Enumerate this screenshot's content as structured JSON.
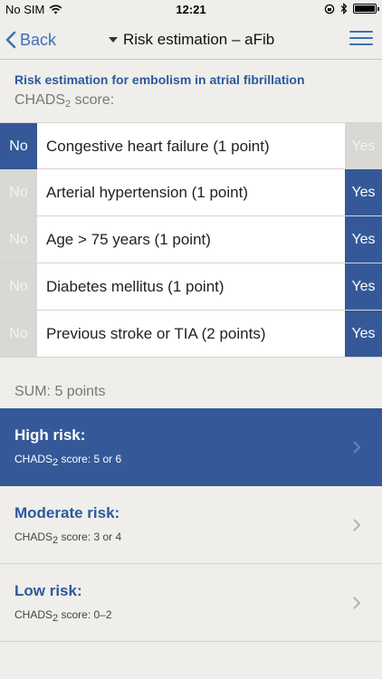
{
  "status_bar": {
    "carrier": "No SIM",
    "time": "12:21"
  },
  "nav": {
    "back_label": "Back",
    "title": "Risk estimation – aFib"
  },
  "section_title": "Risk estimation for embolism in atrial fibrillation",
  "score_label": {
    "prefix": "CHADS",
    "sub": "2",
    "suffix": " score:"
  },
  "options": {
    "no": "No",
    "yes": "Yes"
  },
  "criteria": [
    {
      "label": "Congestive heart failure (1 point)",
      "selected": "no"
    },
    {
      "label": "Arterial hypertension (1 point)",
      "selected": "yes"
    },
    {
      "label": "Age > 75 years (1 point)",
      "selected": "yes"
    },
    {
      "label": "Diabetes mellitus (1 point)",
      "selected": "yes"
    },
    {
      "label": "Previous stroke or TIA (2 points)",
      "selected": "yes"
    }
  ],
  "sum_label": "SUM: 5 points",
  "risks": [
    {
      "title": "High risk:",
      "prefix": "CHADS",
      "sub": "2",
      "suffix": " score: 5 or 6",
      "active": true
    },
    {
      "title": "Moderate risk:",
      "prefix": "CHADS",
      "sub": "2",
      "suffix": " score: 3 or 4",
      "active": false
    },
    {
      "title": "Low risk:",
      "prefix": "CHADS",
      "sub": "2",
      "suffix": " score: 0–2",
      "active": false
    }
  ],
  "colors": {
    "accent": "#355998",
    "link": "#3c6fb5",
    "background": "#efeeeb"
  }
}
